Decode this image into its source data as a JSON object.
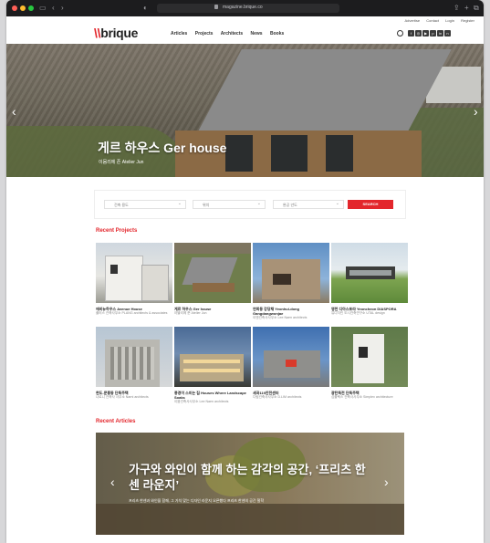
{
  "browser": {
    "url": "magazine.brique.co"
  },
  "top_links": [
    "Advertise",
    "Contact",
    "Login",
    "Register"
  ],
  "site": {
    "logo": "brique",
    "logo_mark": "\\\\"
  },
  "nav": [
    "Articles",
    "Projects",
    "Architects",
    "News",
    "Books"
  ],
  "social_icons": [
    "facebook-icon",
    "instagram-icon",
    "youtube-icon",
    "pinterest-icon",
    "linkedin-icon",
    "naver-icon"
  ],
  "hero": {
    "title": "게르 하우스 Ger house",
    "subtitle": "이뭄리에 존 Atelier Jun",
    "active_slide": 1
  },
  "filters": {
    "select1": "건축 용도",
    "select2": "위치",
    "select3": "완공 년도",
    "search_label": "SEARCH"
  },
  "recent_projects_label": "Recent Projects",
  "projects": [
    {
      "title": "애비뉴하우스 Avenue House",
      "architect": "플러스 건축사무소 PLANG architects & associates"
    },
    {
      "title": "게르 하우스 Ger house",
      "architect": "아뜰리에 준 Atelier Jun"
    },
    {
      "title": "연희동 강당채 Yeonhui-dong Gangdangwonjae",
      "architect": "이엔건축사사무소 Lee Naen architects"
    },
    {
      "title": "영천 디아스포라 Yeoncheon DIASPORA",
      "architect": "유디자인 도시건축연구소 UTAL design"
    },
    {
      "title": "현도-문홍동 단독주택",
      "architect": "나르니 건축사 사무소 Narni architects"
    },
    {
      "title": "풍경이 스미는 집 Houses Where Landscape Soaks",
      "architect": "이뭄건축사사무소 Lee Naen architects"
    },
    {
      "title": "세곡119안전센터",
      "architect": "디림건축사사무소 D.LIM architects"
    },
    {
      "title": "광탄독전 단독주택",
      "architect": "심플렉스 건축사사무소 Simplex architecture"
    }
  ],
  "recent_articles_label": "Recent Articles",
  "article": {
    "title": "가구와 와인이 함께 하는 감각의 공간, ‘프리츠 한센 라운지’",
    "subtitle": "프리츠 한센과 와인을 함께, 그 가치 맞는 디자인 라운지 오픈했다 프리츠 한센의 공간 철학"
  }
}
